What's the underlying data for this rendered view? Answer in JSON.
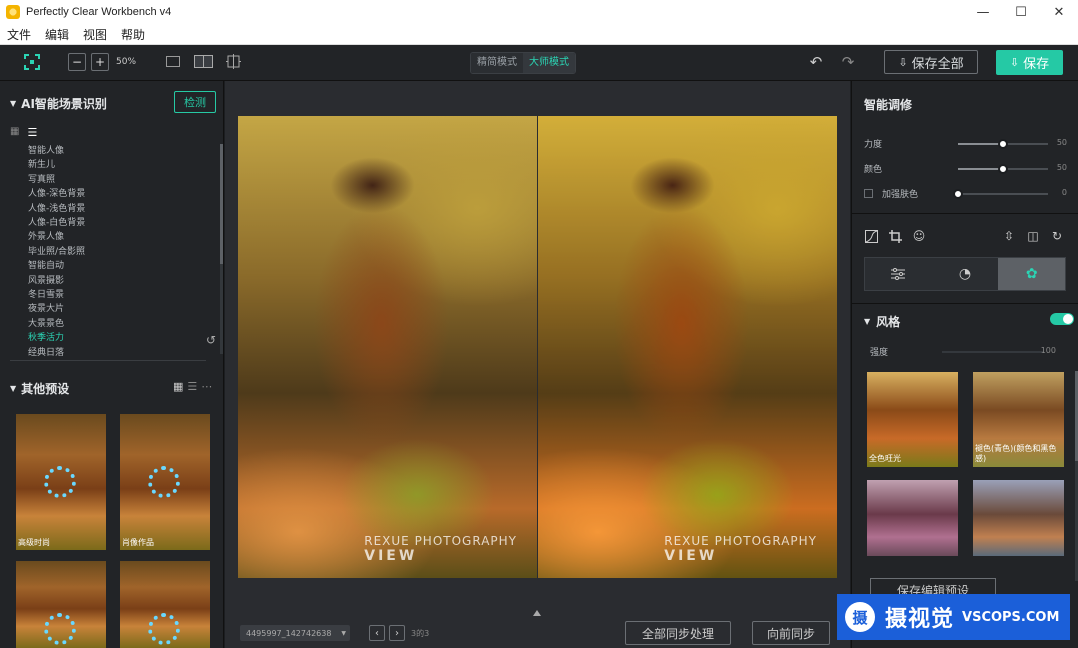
{
  "app": {
    "title": "Perfectly Clear Workbench v4"
  },
  "menu": [
    "文件",
    "编辑",
    "视图",
    "帮助"
  ],
  "toolbar": {
    "zoom_minus": "−",
    "zoom_plus": "+",
    "zoom": "50%",
    "mode_simple": "精简模式",
    "mode_master": "大师模式",
    "save_all": "保存全部",
    "save": "保存"
  },
  "left": {
    "ai_title": "AI智能场景识别",
    "detect_btn": "检测",
    "scenes": [
      "智能人像",
      "新生儿",
      "写真照",
      "人像-深色背景",
      "人像-浅色背景",
      "人像-白色背景",
      "外景人像",
      "毕业照/合影照",
      "智能自动",
      "风景摄影",
      "冬日雪景",
      "夜景大片",
      "大景景色",
      "秋季活力",
      "经典日落"
    ],
    "active_scene": 13,
    "other_title": "其他预设",
    "presets": [
      {
        "caption": "高级时尚"
      },
      {
        "caption": "肖像作品"
      },
      {
        "caption": ""
      },
      {
        "caption": ""
      }
    ]
  },
  "canvas": {
    "watermark_line1": "REXUE PHOTOGRAPHY",
    "watermark_line2": "VIEW",
    "file_name": "4495997_142742638",
    "counter": "3的3",
    "sync_all": "全部同步处理",
    "sync_forward": "向前同步"
  },
  "right": {
    "title": "智能调修",
    "sliders": [
      {
        "label": "力度",
        "value": 50,
        "fraction": 0.5
      },
      {
        "label": "颜色",
        "value": 50,
        "fraction": 0.5
      },
      {
        "label": "加强肤色",
        "value": 0,
        "fraction": 0.0
      }
    ],
    "style_title": "风格",
    "intensity_label": "强度",
    "intensity_value": 100,
    "styles": [
      {
        "caption": "全色旺光"
      },
      {
        "caption": "褪色(青色)(颜色和黑色感)"
      },
      {
        "caption": ""
      },
      {
        "caption": ""
      }
    ],
    "save_preset": "保存编辑预设"
  },
  "badge": {
    "logo": "摄",
    "cn": "摄视觉",
    "en": "VSCOPS.COM"
  },
  "colors": {
    "accent": "#25c9a5",
    "bg": "#222427",
    "badge": "#1b5fd9"
  }
}
